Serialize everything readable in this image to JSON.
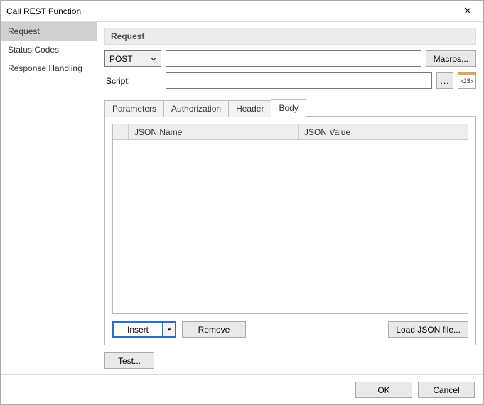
{
  "window": {
    "title": "Call REST Function"
  },
  "sidebar": {
    "items": [
      {
        "label": "Request",
        "selected": true
      },
      {
        "label": "Status Codes",
        "selected": false
      },
      {
        "label": "Response Handling",
        "selected": false
      }
    ]
  },
  "request": {
    "section_title": "Request",
    "method": "POST",
    "url_value": "",
    "macros_label": "Macros...",
    "script_label": "Script:",
    "script_value": "",
    "ellipsis_label": "...",
    "js_label": "‹JS›"
  },
  "tabs": [
    {
      "label": "Parameters",
      "active": false
    },
    {
      "label": "Authorization",
      "active": false
    },
    {
      "label": "Header",
      "active": false
    },
    {
      "label": "Body",
      "active": true
    }
  ],
  "body_tab": {
    "columns": [
      "JSON Name",
      "JSON Value"
    ],
    "rows": [],
    "insert_label": "Insert",
    "remove_label": "Remove",
    "load_label": "Load JSON file..."
  },
  "actions": {
    "test_label": "Test...",
    "ok_label": "OK",
    "cancel_label": "Cancel"
  }
}
